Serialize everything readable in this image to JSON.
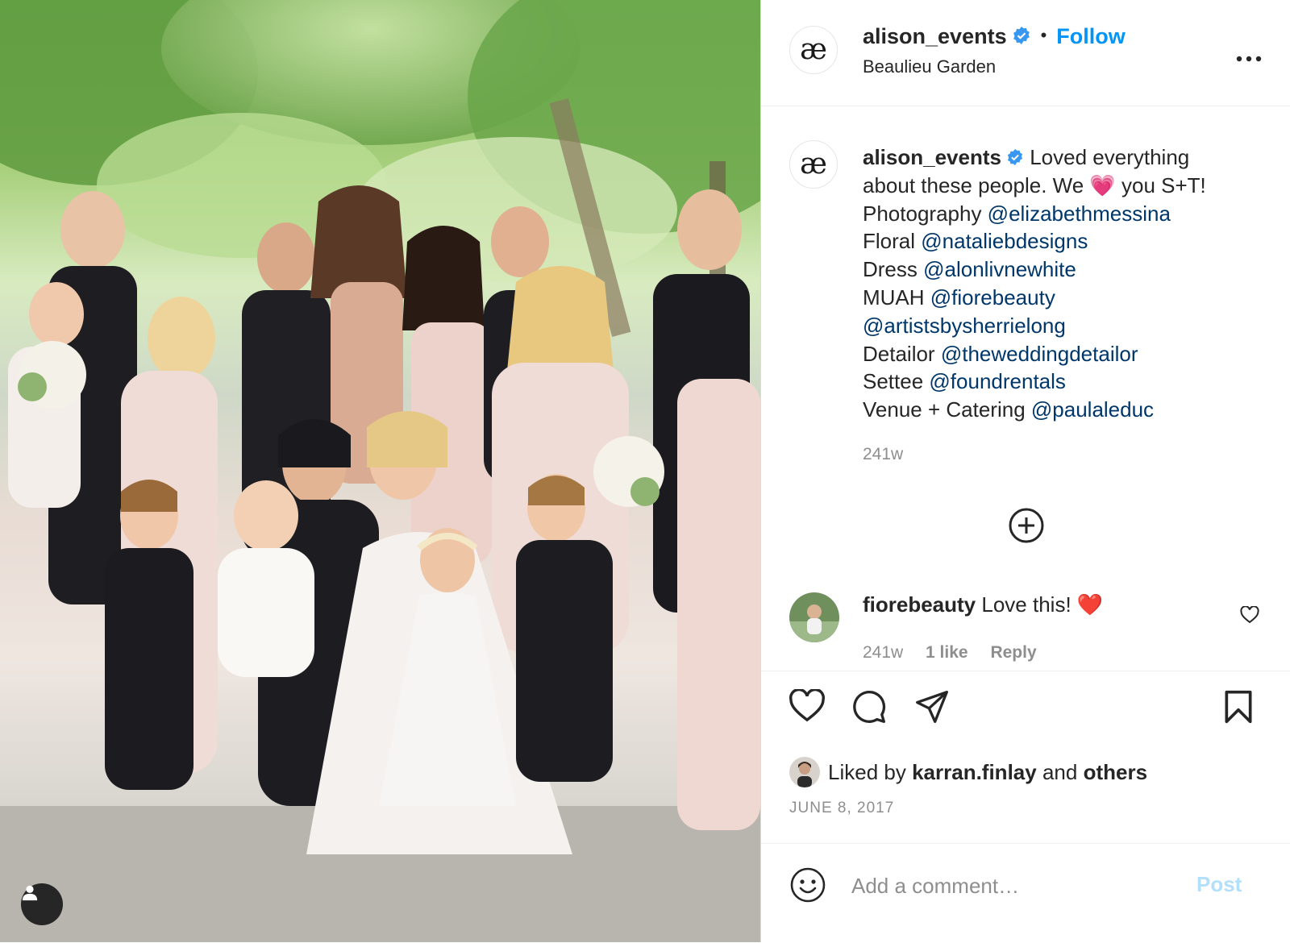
{
  "header": {
    "username": "alison_events",
    "separator": "•",
    "follow_label": "Follow",
    "location": "Beaulieu Garden",
    "avatar_glyph": "æ"
  },
  "caption": {
    "username": "alison_events",
    "lines": [
      {
        "prefix": "Loved everything",
        "mention": ""
      },
      {
        "prefix": "about these people. We 💗 you S+T!",
        "mention": ""
      },
      {
        "prefix": "Photography ",
        "mention": "@elizabethmessina"
      },
      {
        "prefix": "Floral ",
        "mention": "@nataliebdesigns"
      },
      {
        "prefix": "Dress ",
        "mention": "@alonlivnewhite"
      },
      {
        "prefix": "MUAH ",
        "mention": "@fiorebeauty"
      },
      {
        "prefix": "",
        "mention": "@artistsbysherrielong"
      },
      {
        "prefix": "Detailor ",
        "mention": "@theweddingdetailor"
      },
      {
        "prefix": "Settee ",
        "mention": "@foundrentals"
      },
      {
        "prefix": "Venue + Catering ",
        "mention": "@paulaleduc"
      }
    ],
    "time": "241w"
  },
  "comment": {
    "username": "fiorebeauty",
    "text": "Love this! ❤️",
    "time": "241w",
    "likes": "1 like",
    "reply_label": "Reply"
  },
  "likes": {
    "prefix": "Liked by",
    "user": "karran.finlay",
    "and": "and",
    "others": "others"
  },
  "date": "JUNE 8, 2017",
  "composer": {
    "placeholder": "Add a comment…",
    "post_label": "Post"
  },
  "icons": {
    "verified": "verified-badge-icon",
    "more": "more-options-icon",
    "load_more": "plus-circle-icon",
    "like": "heart-icon",
    "comment": "speech-bubble-icon",
    "share": "paper-plane-icon",
    "save": "bookmark-icon",
    "emoji": "smiley-icon",
    "tag": "user-tag-icon"
  },
  "colors": {
    "accent": "#0095f6",
    "mention": "#00376b",
    "verified": "#3897f0",
    "post_disabled": "#b2dffc"
  }
}
